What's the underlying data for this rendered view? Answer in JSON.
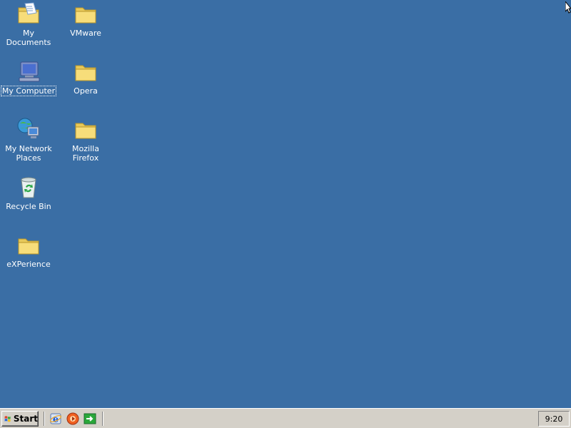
{
  "desktop": {
    "icons": [
      {
        "label": "My Documents",
        "icon": "my-documents-icon"
      },
      {
        "label": "VMware",
        "icon": "folder-icon"
      },
      {
        "label": "My Computer",
        "icon": "my-computer-icon",
        "selected": true
      },
      {
        "label": "Opera",
        "icon": "folder-icon"
      },
      {
        "label": "My Network Places",
        "icon": "network-places-icon"
      },
      {
        "label": "Mozilla Firefox",
        "icon": "folder-icon"
      },
      {
        "label": "Recycle Bin",
        "icon": "recycle-bin-icon"
      },
      {
        "label": "eXPerience",
        "icon": "folder-icon"
      }
    ],
    "background_color": "#3a6ea5"
  },
  "taskbar": {
    "start_label": "Start",
    "quick_launch": [
      {
        "icon": "internet-explorer-icon"
      },
      {
        "icon": "media-player-icon"
      },
      {
        "icon": "show-desktop-icon"
      }
    ],
    "clock": "9:20"
  }
}
